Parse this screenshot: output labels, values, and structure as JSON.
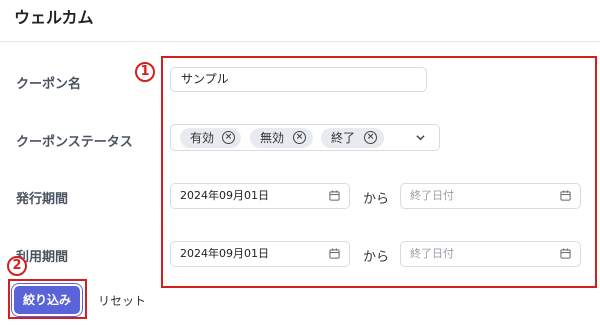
{
  "header": {
    "title": "ウェルカム"
  },
  "form": {
    "coupon_name": {
      "label": "クーポン名",
      "value": "サンプル"
    },
    "coupon_status": {
      "label": "クーポンステータス",
      "chips": [
        {
          "label": "有効"
        },
        {
          "label": "無効"
        },
        {
          "label": "終了"
        }
      ]
    },
    "issue_period": {
      "label": "発行期間",
      "start_value": "2024年09月01日",
      "separator": "から",
      "end_placeholder": "終了日付"
    },
    "use_period": {
      "label": "利用期間",
      "start_value": "2024年09月01日",
      "separator": "から",
      "end_placeholder": "終了日付"
    }
  },
  "actions": {
    "filter_label": "絞り込み",
    "reset_label": "リセット"
  },
  "annotations": {
    "badge1": "1",
    "badge2": "2",
    "color": "#d41f1f"
  },
  "colors": {
    "primary": "#5b63d9",
    "chip_bg": "#e7eaee"
  }
}
